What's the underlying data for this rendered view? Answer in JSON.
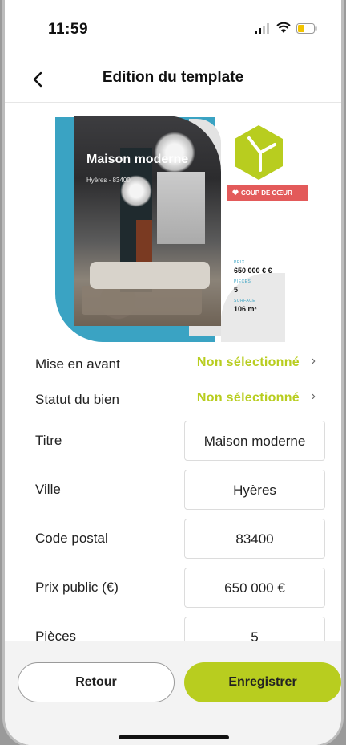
{
  "status_bar": {
    "time": "11:59"
  },
  "nav": {
    "title": "Edition du template"
  },
  "preview": {
    "title": "Maison moderne",
    "location": "Hyères - 83400",
    "badge": "COUP DE CŒUR",
    "stats": [
      {
        "label": "PRIX",
        "value": "650 000 € €"
      },
      {
        "label": "PIÈCES",
        "value": "5"
      },
      {
        "label": "SURFACE",
        "value": "106 m²"
      }
    ]
  },
  "form": {
    "selects": [
      {
        "label": "Mise en avant",
        "value": "Non sélectionné"
      },
      {
        "label": "Statut du bien",
        "value": "Non sélectionné"
      }
    ],
    "inputs": [
      {
        "label": "Titre",
        "value": "Maison moderne"
      },
      {
        "label": "Ville",
        "value": "Hyères"
      },
      {
        "label": "Code postal",
        "value": "83400"
      },
      {
        "label": "Prix public (€)",
        "value": "650 000 €"
      },
      {
        "label": "Pièces",
        "value": "5"
      }
    ]
  },
  "actions": {
    "back_label": "Retour",
    "save_label": "Enregistrer"
  },
  "colors": {
    "accent": "#b8cd1f",
    "blue": "#3aa3c3",
    "badge": "#e35a5a"
  }
}
